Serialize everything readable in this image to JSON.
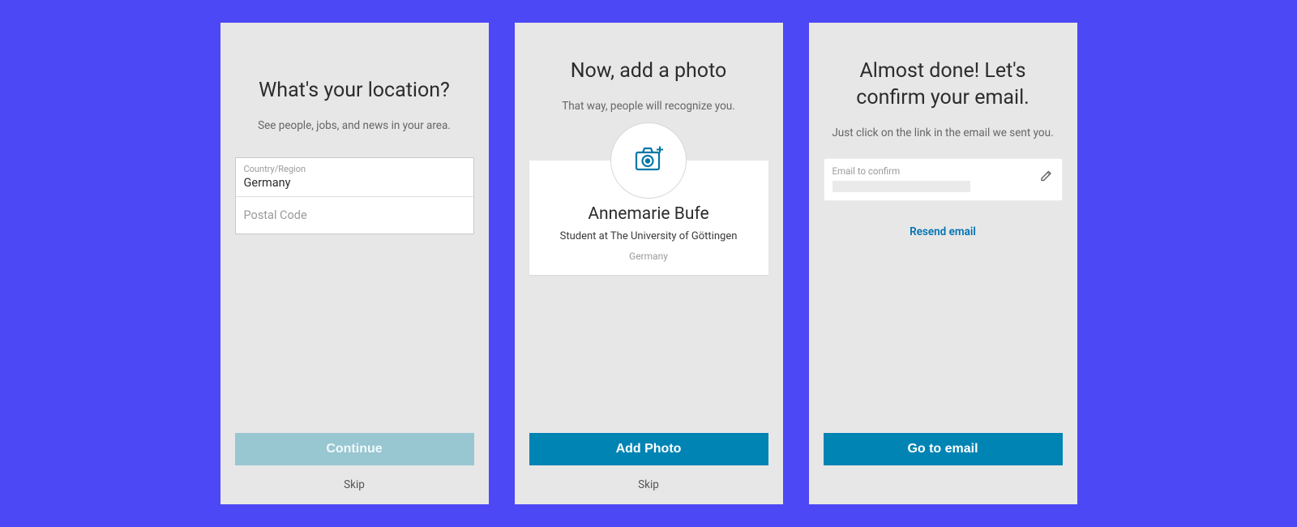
{
  "screen1": {
    "title": "What's your location?",
    "subtitle": "See people, jobs, and news in your area.",
    "country_label": "Country/Region",
    "country_value": "Germany",
    "postal_placeholder": "Postal Code",
    "continue_label": "Continue",
    "skip_label": "Skip"
  },
  "screen2": {
    "title": "Now, add a photo",
    "subtitle": "That way, people will recognize you.",
    "profile_name": "Annemarie Bufe",
    "profile_role": "Student at The University of Göttingen",
    "profile_country": "Germany",
    "add_photo_label": "Add Photo",
    "skip_label": "Skip"
  },
  "screen3": {
    "title": "Almost done! Let's confirm your email.",
    "subtitle": "Just click on the link in the email we sent you.",
    "email_label": "Email to confirm",
    "resend_label": "Resend email",
    "go_label": "Go to email"
  },
  "colors": {
    "bg": "#4d48f5",
    "primary": "#0084b4",
    "primary_muted": "#98c6d1",
    "link": "#0073b1"
  }
}
